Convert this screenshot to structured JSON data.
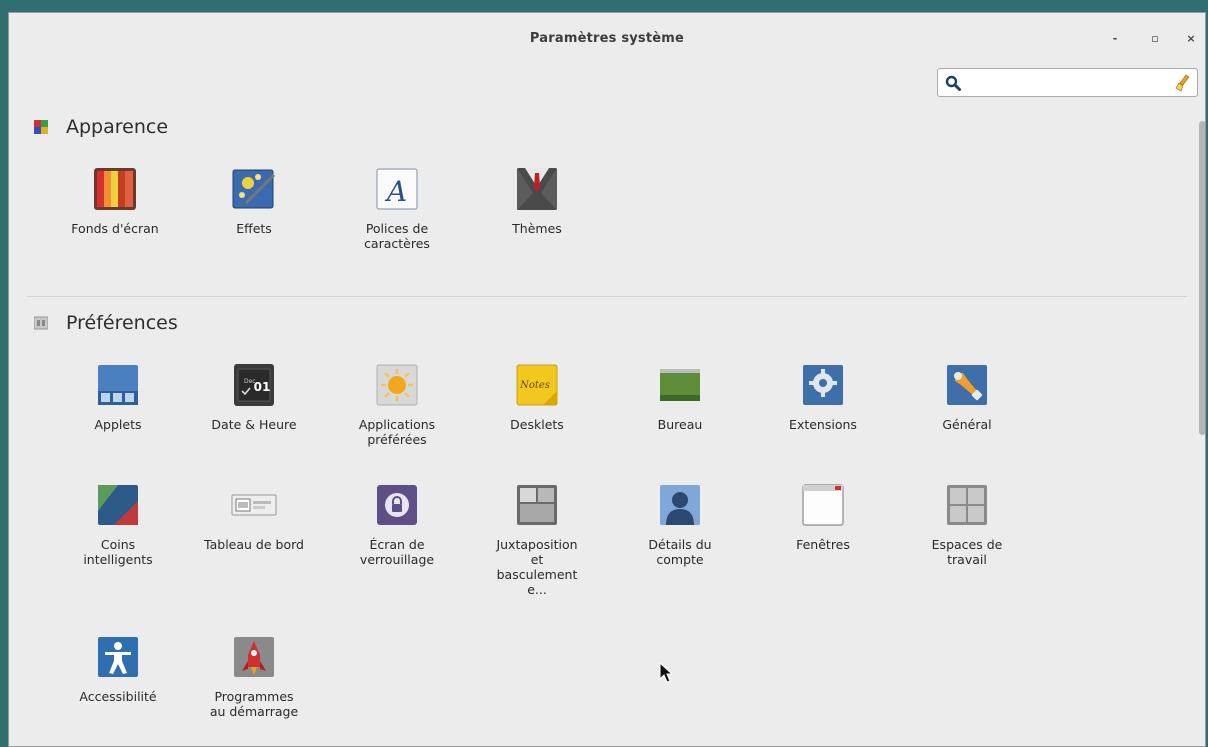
{
  "window": {
    "title": "Paramètres système",
    "controls": {
      "minimize": "-",
      "maximize": "▫",
      "close": "×"
    }
  },
  "search": {
    "value": "",
    "placeholder": ""
  },
  "sections": {
    "apparence": {
      "title": "Apparence",
      "items": [
        {
          "label": "Fonds d'écran",
          "icon": "wallpaper-icon"
        },
        {
          "label": "Effets",
          "icon": "effects-icon"
        },
        {
          "label": "Polices de\ncaractères",
          "icon": "fonts-icon"
        },
        {
          "label": "Thèmes",
          "icon": "themes-icon"
        }
      ]
    },
    "preferences": {
      "title": "Préférences",
      "items": [
        {
          "label": "Applets",
          "icon": "applets-icon"
        },
        {
          "label": "Date & Heure",
          "icon": "date-time-icon"
        },
        {
          "label": "Applications\npréférées",
          "icon": "preferred-apps-icon"
        },
        {
          "label": "Desklets",
          "icon": "desklets-icon"
        },
        {
          "label": "Bureau",
          "icon": "desktop-icon"
        },
        {
          "label": "Extensions",
          "icon": "extensions-icon"
        },
        {
          "label": "Général",
          "icon": "general-icon"
        },
        {
          "label": "Coins\nintelligents",
          "icon": "hot-corners-icon"
        },
        {
          "label": "Tableau de bord",
          "icon": "panel-icon"
        },
        {
          "label": "Écran de\nverrouillage",
          "icon": "lock-screen-icon"
        },
        {
          "label": "Juxtaposition\net\nbasculement\ne...",
          "icon": "tiling-icon"
        },
        {
          "label": "Détails du\ncompte",
          "icon": "account-details-icon"
        },
        {
          "label": "Fenêtres",
          "icon": "windows-icon"
        },
        {
          "label": "Espaces de\ntravail",
          "icon": "workspaces-icon"
        },
        {
          "label": "Accessibilité",
          "icon": "accessibility-icon"
        },
        {
          "label": "Programmes\nau démarrage",
          "icon": "startup-programs-icon"
        }
      ]
    }
  },
  "date_icon": {
    "month": "Dec",
    "day": "01"
  }
}
